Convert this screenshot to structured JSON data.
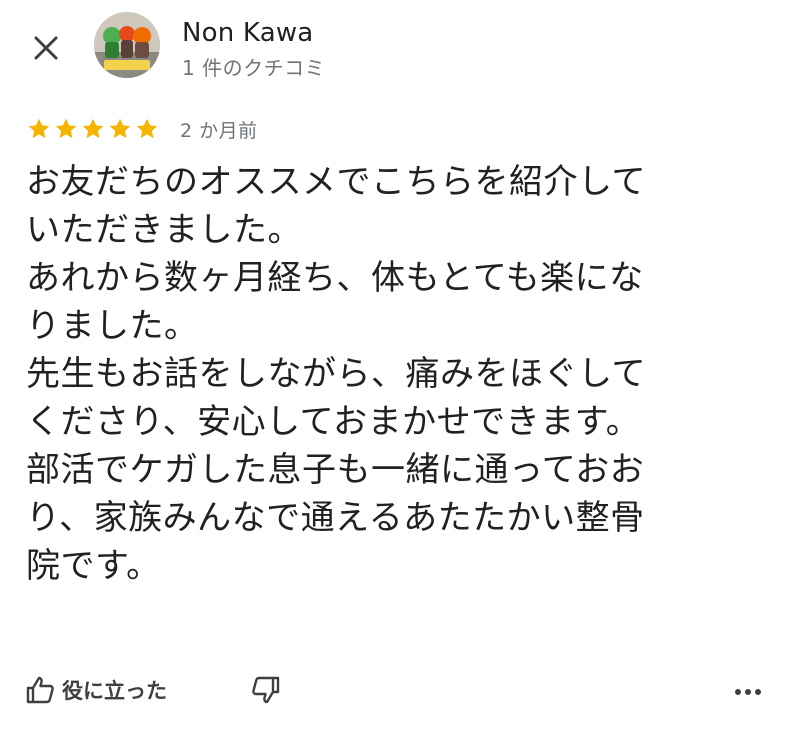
{
  "header": {
    "close_icon": "close-icon",
    "reviewer_name": "Non Kawa",
    "review_count": "1 件のクチコミ"
  },
  "review": {
    "rating": 5,
    "max_rating": 5,
    "star_color": "#f4b400",
    "date": "2 か月前",
    "text": "お友だちのオススメでこちらを紹介して\nいただきました。\nあれから数ヶ月経ち、体もとても楽にな\nりました。\n先生もお話をしながら、痛みをほぐして\nくださり、安心しておまかせできます。\n部活でケガした息子も一緒に通っておお\nり、家族みんなで通えるあたたかい整骨\n院です。"
  },
  "actions": {
    "helpful_label": "役に立った",
    "helpful_icon": "thumb-up-icon",
    "not_helpful_icon": "thumb-down-icon",
    "more_icon": "more-horizontal-icon"
  }
}
